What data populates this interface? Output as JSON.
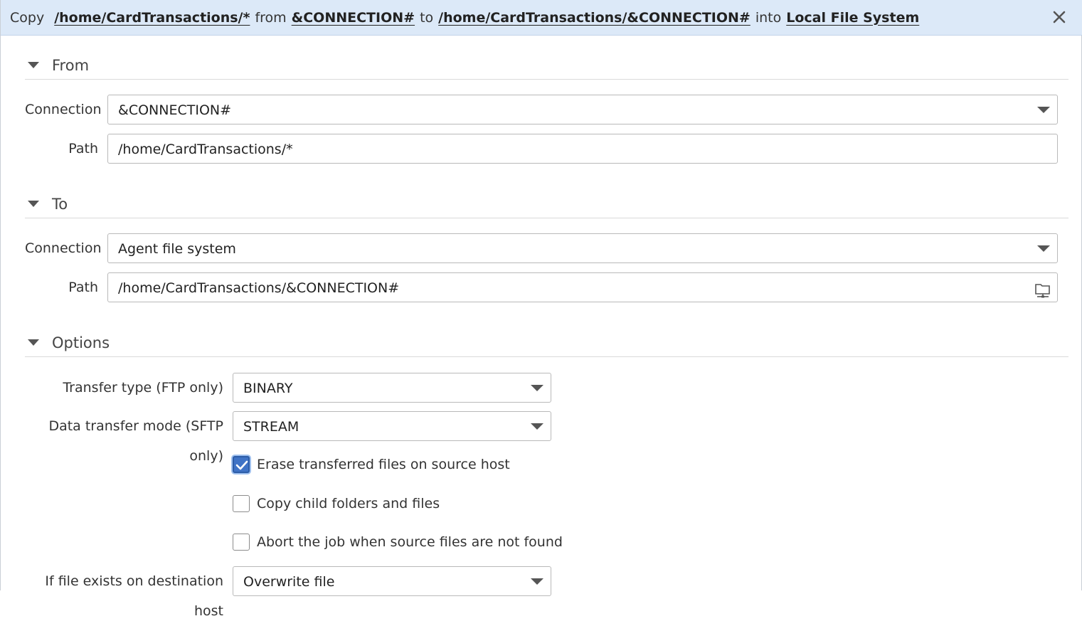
{
  "header": {
    "prefix": "Copy",
    "source_path": "/home/CardTransactions/*",
    "word_from": "from",
    "source_connection": "&CONNECTION#",
    "word_to": "to",
    "dest_path": "/home/CardTransactions/&CONNECTION#",
    "word_into": "into",
    "dest_system": "Local File System",
    "close_icon": "close-icon"
  },
  "from": {
    "title": "From",
    "connection_label": "Connection",
    "connection_value": "&CONNECTION#",
    "path_label": "Path",
    "path_value": "/home/CardTransactions/*"
  },
  "to": {
    "title": "To",
    "connection_label": "Connection",
    "connection_value": "Agent file system",
    "path_label": "Path",
    "path_value": "/home/CardTransactions/&CONNECTION#",
    "browse_icon": "browse-remote-folder-icon"
  },
  "options": {
    "title": "Options",
    "transfer_type_label": "Transfer type (FTP only)",
    "transfer_type_value": "BINARY",
    "data_mode_label": "Data transfer mode (SFTP only)",
    "data_mode_value": "STREAM",
    "erase_label": "Erase transferred files on source host",
    "erase_checked": true,
    "copy_child_label": "Copy child folders and files",
    "copy_child_checked": false,
    "abort_label": "Abort the job when source files are not found",
    "abort_checked": false,
    "if_exists_label": "If file exists on destination host",
    "if_exists_value": "Overwrite file"
  },
  "colors": {
    "header_bg": "#dce9f8",
    "checkbox_checked": "#3f73c6"
  }
}
